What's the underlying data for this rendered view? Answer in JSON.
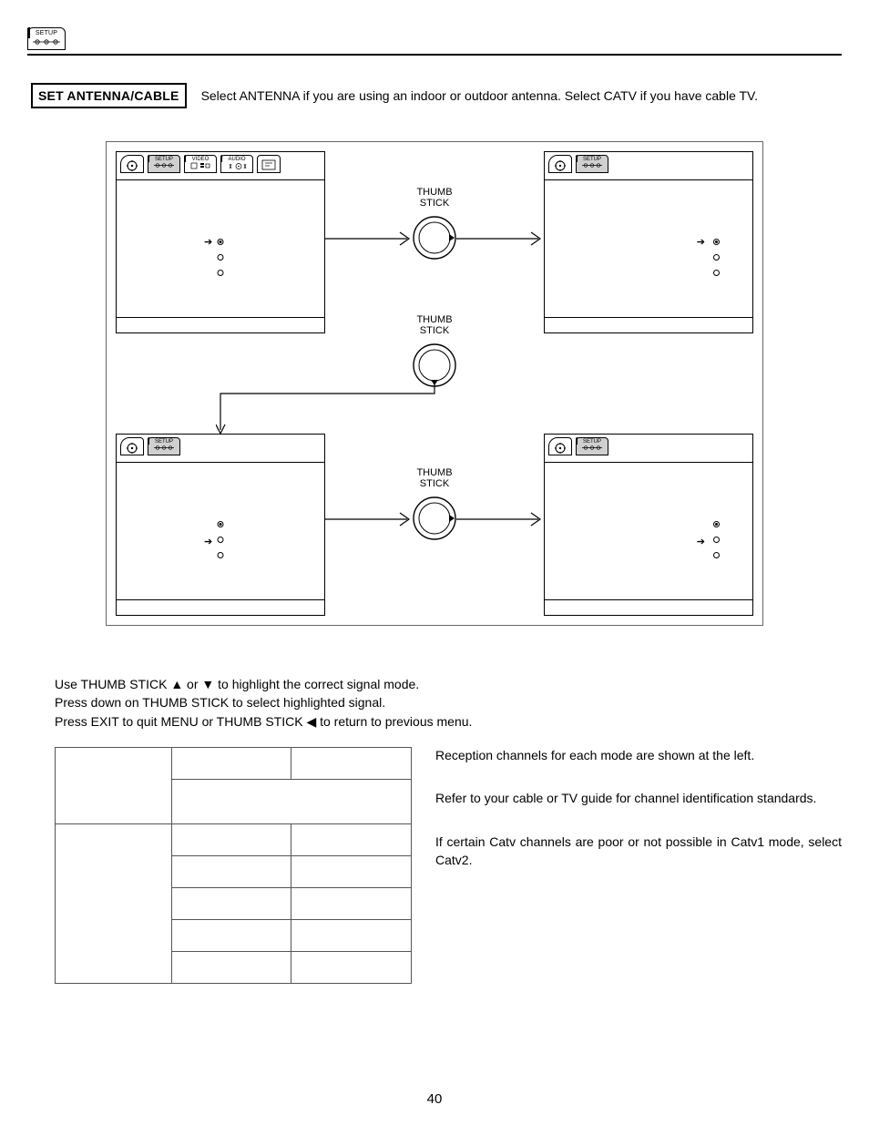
{
  "header": {
    "chip_label": "SETUP"
  },
  "section": {
    "title": "SET ANTENNA/CABLE",
    "desc": "Select ANTENNA if you are using an indoor or outdoor antenna.  Select CATV if you have cable TV."
  },
  "tabs": {
    "setup": "SETUP",
    "video": "VIDEO",
    "audio": "AUDIO"
  },
  "labels": {
    "thumb_stick": "THUMB STICK"
  },
  "instructions": {
    "l1_a": "Use THUMB STICK ",
    "l1_b": " or ",
    "l1_c": " to highlight the correct signal mode.",
    "l2": "Press down on THUMB STICK to select highlighted signal.",
    "l3_a": "Press EXIT to quit MENU or THUMB STICK ",
    "l3_b": " to return to previous menu."
  },
  "glyphs": {
    "up": "▲",
    "down": "▼",
    "left": "◀"
  },
  "side_notes": {
    "n1": "Reception channels for each mode are shown at the left.",
    "n2": "Refer to your cable or TV guide for channel identification standards.",
    "n3": "If certain Catv channels are poor or not possible in Catv1 mode, select Catv2."
  },
  "page_number": "40",
  "chart_data": {
    "type": "table",
    "note": "Signal-mode reception-channel table shown blank in this scan; 2 header cells over 3 columns, then 5 body rows.",
    "columns": 3,
    "rows": 7
  }
}
